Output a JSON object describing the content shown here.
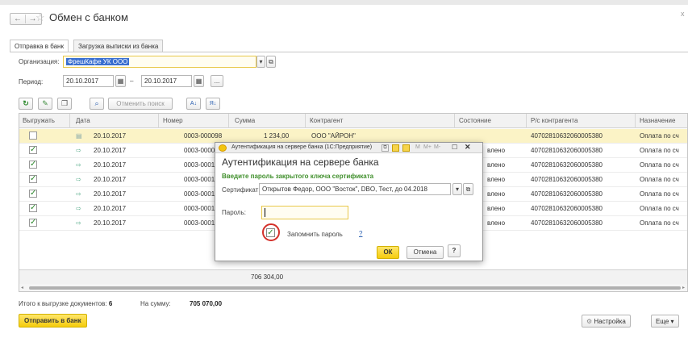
{
  "window": {
    "title": "Обмен с банком"
  },
  "nav": {
    "back_icon": "←",
    "forward_icon": "→",
    "favorite_icon": "☆",
    "close_icon": "x"
  },
  "tabs": [
    {
      "label": "Отправка в банк",
      "active": true
    },
    {
      "label": "Загрузка выписки из банка",
      "active": false
    }
  ],
  "form": {
    "org_label": "Организация:",
    "org_value": "ФрешКафе УК ООО",
    "period_label": "Период:",
    "date_from": "20.10.2017",
    "dash": "–",
    "date_to": "20.10.2017",
    "more_label": "..."
  },
  "toolbar": {
    "refresh_icon": "refresh-icon",
    "cancel_search_label": "Отменить поиск"
  },
  "table": {
    "columns": [
      "Выгружать",
      "Дата",
      "Номер",
      "Сумма",
      "Контрагент",
      "Состояние",
      "Р/с контрагента",
      "Назначение"
    ],
    "rows": [
      {
        "checked": false,
        "date": "20.10.2017",
        "number": "0003-000098",
        "sum": "1 234,00",
        "counterparty": "ООО \"АЙРОН\"",
        "state": "",
        "account": "40702810632060005380",
        "purpose": "Оплата по сч"
      },
      {
        "checked": true,
        "date": "20.10.2017",
        "number": "0003-0000",
        "sum": "",
        "counterparty": "",
        "state": "влено",
        "account": "40702810632060005380",
        "purpose": "Оплата по сч"
      },
      {
        "checked": true,
        "date": "20.10.2017",
        "number": "0003-0001",
        "sum": "",
        "counterparty": "",
        "state": "влено",
        "account": "40702810632060005380",
        "purpose": "Оплата по сч"
      },
      {
        "checked": true,
        "date": "20.10.2017",
        "number": "0003-0001",
        "sum": "",
        "counterparty": "",
        "state": "влено",
        "account": "40702810632060005380",
        "purpose": "Оплата по сч"
      },
      {
        "checked": true,
        "date": "20.10.2017",
        "number": "0003-0001",
        "sum": "",
        "counterparty": "",
        "state": "влено",
        "account": "40702810632060005380",
        "purpose": "Оплата по сч"
      },
      {
        "checked": true,
        "date": "20.10.2017",
        "number": "0003-0001",
        "sum": "",
        "counterparty": "",
        "state": "влено",
        "account": "40702810632060005380",
        "purpose": "Оплата по сч"
      },
      {
        "checked": true,
        "date": "20.10.2017",
        "number": "0003-0001",
        "sum": "",
        "counterparty": "",
        "state": "влено",
        "account": "40702810632060005380",
        "purpose": "Оплата по сч"
      }
    ],
    "footer_sum": "706 304,00"
  },
  "summary": {
    "docs_label": "Итого к выгрузке документов:",
    "docs_count": "6",
    "sum_label": "На сумму:",
    "sum_value": "705 070,00"
  },
  "bottom": {
    "send_label": "Отправить в банк",
    "settings_label": "Настройка",
    "more_label": "Еще ▾"
  },
  "dialog": {
    "window_title": "Аутентификация на сервере банка (1С:Предприятие)",
    "title_tools": [
      "M",
      "M+",
      "M-"
    ],
    "heading": "Аутентификация на сервере банка",
    "prompt": "Введите пароль закрытого ключа сертификата",
    "cert_label": "Сертификат:",
    "cert_value": "Открытов Федор, ООО \"Восток\", DBO, Тест, до 04.2018",
    "password_label": "Пароль:",
    "password_value": "",
    "remember_label": "Запомнить пароль",
    "remember_checked": true,
    "help_link": "?",
    "ok_label": "ОК",
    "cancel_label": "Отмена",
    "help_label": "?"
  }
}
